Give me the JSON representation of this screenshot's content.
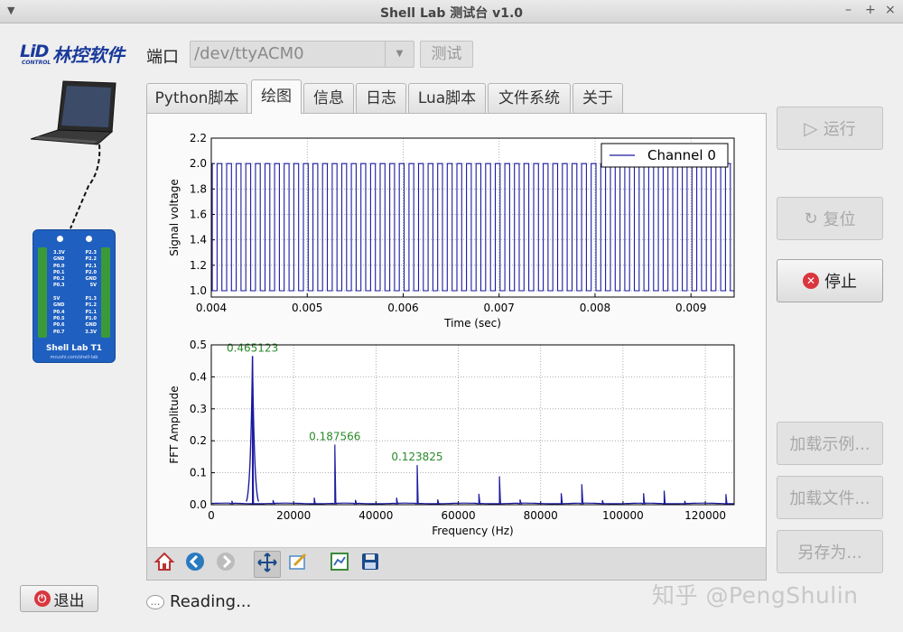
{
  "window": {
    "title": "Shell Lab 测试台 v1.0",
    "min": "–",
    "max": "+",
    "close": "×"
  },
  "logo": {
    "mark": "LiD",
    "name": "林控软件",
    "sub": "CONTROL"
  },
  "device": {
    "name": "Shell Lab T1",
    "url": "mcushi.com/shell-lab",
    "pins_left_a": [
      "3.3V",
      "GND",
      "P0.0",
      "P0.1",
      "P0.2",
      "P0.3"
    ],
    "pins_right_a": [
      "P2.3",
      "P2.2",
      "P2.1",
      "P2.0",
      "GND",
      "5V"
    ],
    "pins_left_b": [
      "5V",
      "GND",
      "P0.4",
      "P0.5",
      "P0.6",
      "P0.7"
    ],
    "pins_right_b": [
      "P1.3",
      "P1.2",
      "P1.1",
      "P1.0",
      "GND",
      "3.3V"
    ]
  },
  "port": {
    "label": "端口",
    "value": "/dev/ttyACM0",
    "test_label": "测试"
  },
  "tabs": [
    "Python脚本",
    "绘图",
    "信息",
    "日志",
    "Lua脚本",
    "文件系统",
    "关于"
  ],
  "active_tab": "绘图",
  "buttons": {
    "run": "运行",
    "reset": "复位",
    "stop": "停止",
    "load_example": "加载示例...",
    "load_file": "加载文件...",
    "save_as": "另存为...",
    "exit": "退出"
  },
  "status": "Reading...",
  "watermark": "知乎 @PengShulin",
  "chart_data": [
    {
      "type": "line",
      "title": "",
      "xlabel": "Time (sec)",
      "ylabel": "Signal voltage",
      "xlim": [
        0.004,
        0.00945
      ],
      "ylim": [
        0.95,
        2.2
      ],
      "xticks": [
        "0.004",
        "0.005",
        "0.006",
        "0.007",
        "0.008",
        "0.009"
      ],
      "yticks": [
        "1.0",
        "1.2",
        "1.4",
        "1.6",
        "1.8",
        "2.0",
        "2.2"
      ],
      "grid": true,
      "legend": {
        "position": "top-right",
        "entries": [
          "Channel 0"
        ]
      },
      "series": [
        {
          "name": "Channel 0",
          "kind": "square-wave",
          "low": 1.0,
          "high": 2.0,
          "frequency_hz": 10000,
          "color": "#1a1aa0"
        }
      ]
    },
    {
      "type": "line",
      "title": "",
      "xlabel": "Frequency (Hz)",
      "ylabel": "FFT Amplitude",
      "xlim": [
        0,
        127000
      ],
      "ylim": [
        0,
        0.5
      ],
      "xticks": [
        "0",
        "20000",
        "40000",
        "60000",
        "80000",
        "100000",
        "120000"
      ],
      "yticks": [
        "0.0",
        "0.1",
        "0.2",
        "0.3",
        "0.4",
        "0.5"
      ],
      "grid": true,
      "annotations": [
        "0.465123",
        "0.187566",
        "0.123825"
      ],
      "peaks": [
        {
          "x": 10000,
          "y": 0.465
        },
        {
          "x": 30000,
          "y": 0.188
        },
        {
          "x": 50000,
          "y": 0.124
        },
        {
          "x": 70000,
          "y": 0.089
        },
        {
          "x": 90000,
          "y": 0.064
        },
        {
          "x": 110000,
          "y": 0.044
        },
        {
          "x": 5000,
          "y": 0.012
        },
        {
          "x": 15000,
          "y": 0.014
        },
        {
          "x": 25000,
          "y": 0.022
        },
        {
          "x": 35000,
          "y": 0.015
        },
        {
          "x": 45000,
          "y": 0.022
        },
        {
          "x": 55000,
          "y": 0.016
        },
        {
          "x": 65000,
          "y": 0.034
        },
        {
          "x": 75000,
          "y": 0.016
        },
        {
          "x": 85000,
          "y": 0.036
        },
        {
          "x": 95000,
          "y": 0.014
        },
        {
          "x": 105000,
          "y": 0.036
        },
        {
          "x": 115000,
          "y": 0.012
        },
        {
          "x": 125000,
          "y": 0.033
        }
      ],
      "color": "#1a1aa0"
    }
  ],
  "colors": {
    "trace": "#1a1aa0",
    "annotation": "#2a8a2a",
    "logo": "#1a3a9a",
    "stop": "#d9363e"
  }
}
